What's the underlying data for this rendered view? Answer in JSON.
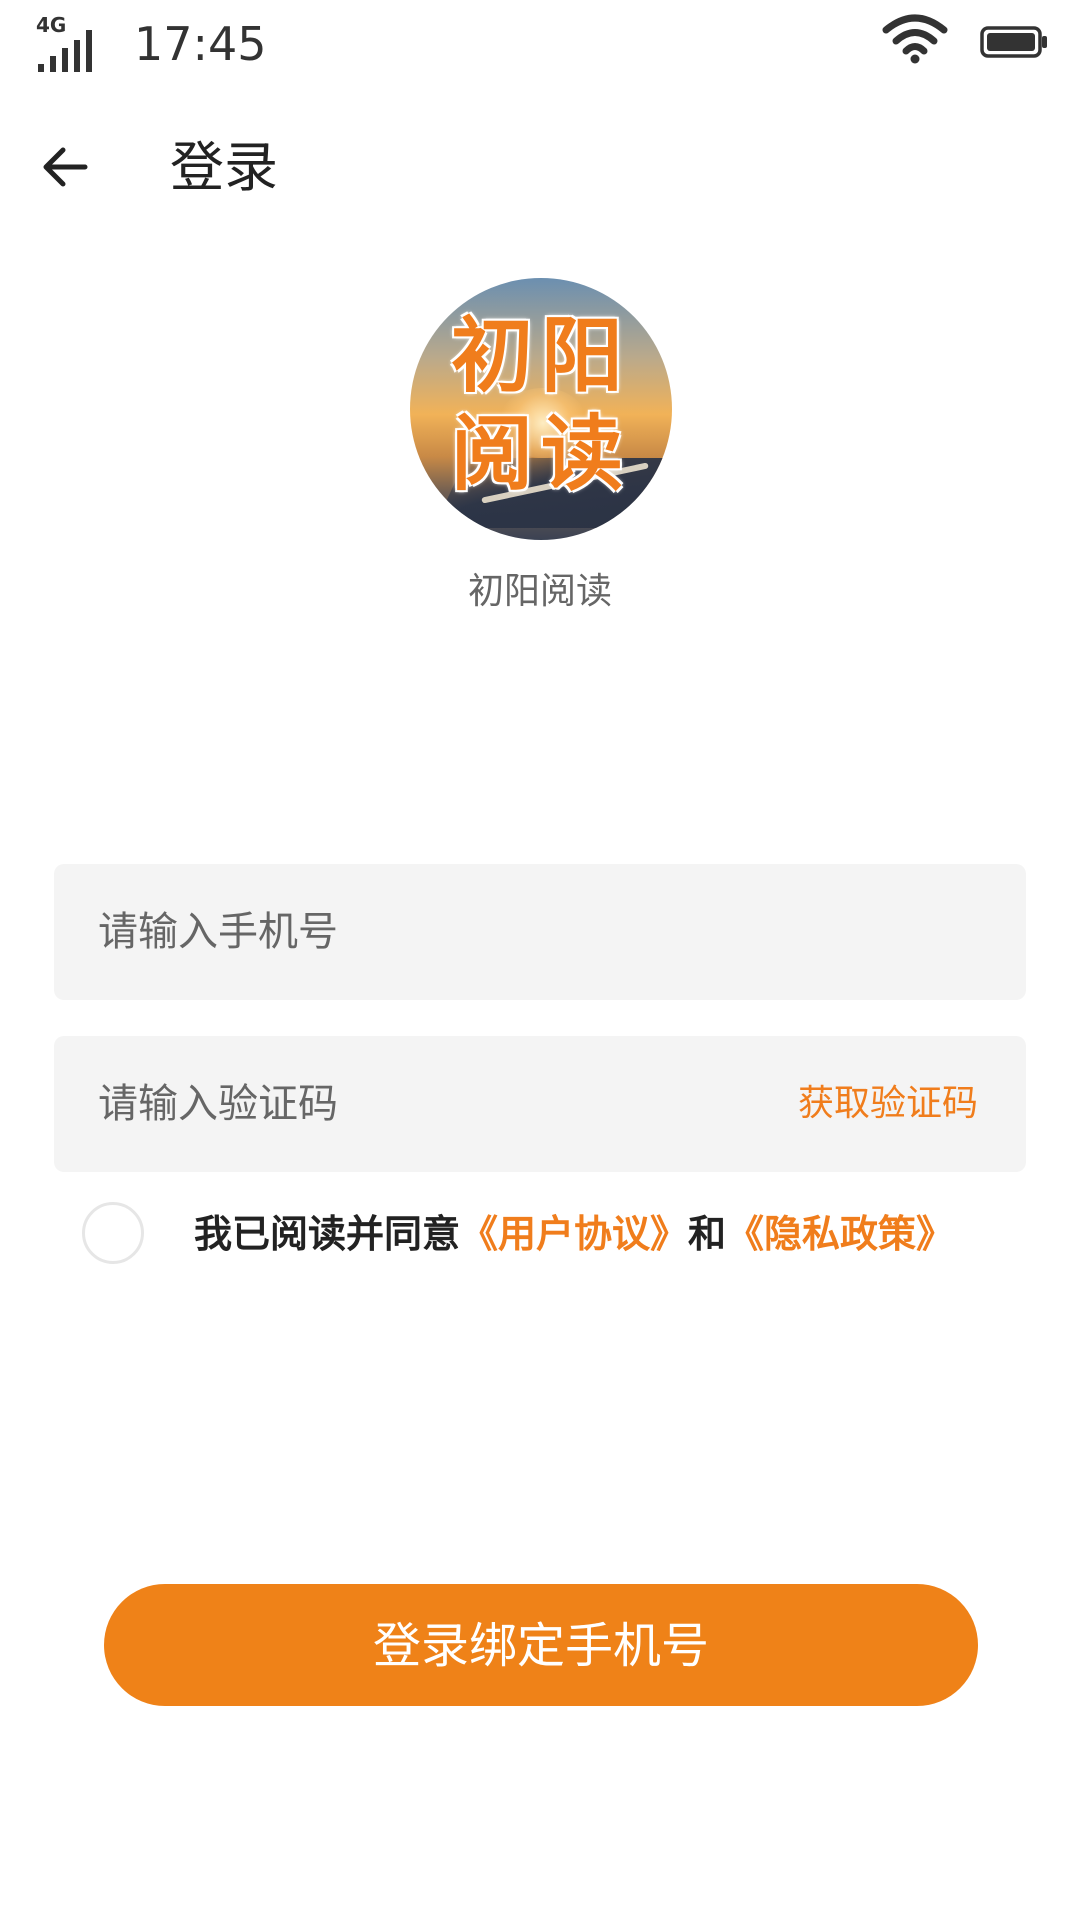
{
  "status_bar": {
    "network": "4G",
    "time": "17:45"
  },
  "header": {
    "title": "登录"
  },
  "logo": {
    "line1": "初阳",
    "line2": "阅读"
  },
  "app_name": "初阳阅读",
  "form": {
    "phone_placeholder": "请输入手机号",
    "phone_value": "",
    "code_placeholder": "请输入验证码",
    "code_value": "",
    "get_code_label": "获取验证码"
  },
  "agreement": {
    "prefix": "我已阅读并同意",
    "user_agreement": "《用户协议》",
    "and": "和",
    "privacy_policy": "《隐私政策》",
    "checked": false
  },
  "login_button": {
    "label": "登录绑定手机号"
  },
  "colors": {
    "accent": "#ef8218",
    "input_bg": "#f4f4f4"
  },
  "icons": {
    "signal": "signal-4g-icon",
    "wifi": "wifi-icon",
    "battery": "battery-icon",
    "back": "back-arrow-icon"
  }
}
